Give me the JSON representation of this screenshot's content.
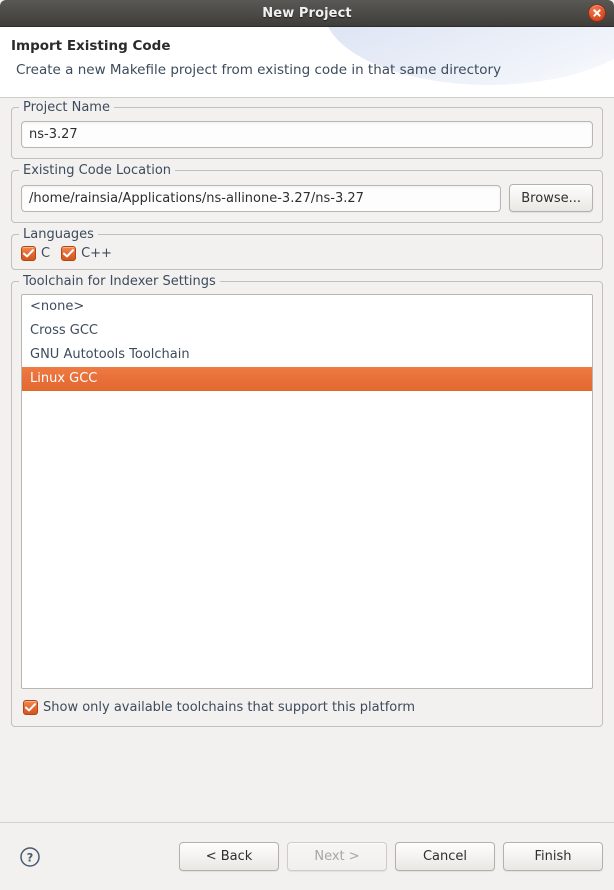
{
  "window": {
    "title": "New Project",
    "close_icon": "close-icon"
  },
  "header": {
    "title": "Import Existing Code",
    "subtitle": "Create a new Makefile project from existing code in that same directory"
  },
  "project_name": {
    "group_label": "Project Name",
    "value": "ns-3.27",
    "placeholder": ""
  },
  "existing_code_location": {
    "group_label": "Existing Code Location",
    "value": "/home/rainsia/Applications/ns-allinone-3.27/ns-3.27",
    "placeholder": "",
    "browse_label": "Browse..."
  },
  "languages": {
    "group_label": "Languages",
    "options": [
      {
        "label": "C",
        "checked": true
      },
      {
        "label": "C++",
        "checked": true
      }
    ]
  },
  "toolchain": {
    "group_label": "Toolchain for Indexer Settings",
    "items": [
      {
        "label": "<none>",
        "selected": false
      },
      {
        "label": "Cross GCC",
        "selected": false
      },
      {
        "label": "GNU Autotools Toolchain",
        "selected": false
      },
      {
        "label": "Linux GCC",
        "selected": true
      }
    ],
    "show_only_available": {
      "label": "Show only available toolchains that support this platform",
      "checked": true
    }
  },
  "footer": {
    "help_icon": "help-icon",
    "buttons": [
      {
        "label": "< Back",
        "enabled": true
      },
      {
        "label": "Next >",
        "enabled": false
      },
      {
        "label": "Cancel",
        "enabled": true
      },
      {
        "label": "Finish",
        "enabled": true
      }
    ]
  },
  "colors": {
    "accent": "#e8703a",
    "titlebar": "#4e4c49",
    "body_bg": "#f2f1f0",
    "text": "#3d4b5c"
  }
}
